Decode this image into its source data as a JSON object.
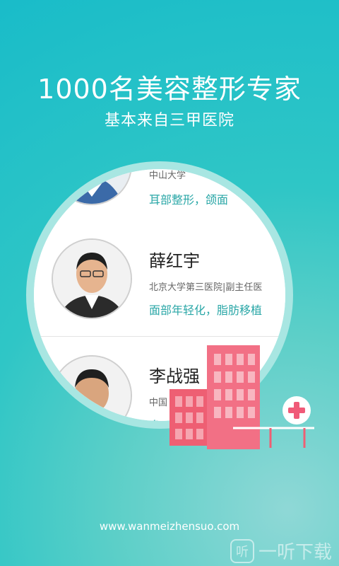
{
  "headline": "1000名美容整形专家",
  "subline": "基本来自三甲医院",
  "doctors": [
    {
      "name": "",
      "hospital": "中山大学",
      "specialty": "耳部整形，颌面"
    },
    {
      "name": "薛红宇",
      "hospital": "北京大学第三医院|副主任医",
      "specialty": "面部年轻化，脂肪移植"
    },
    {
      "name": "李战强",
      "hospital": "中国",
      "specialty": "鼻"
    }
  ],
  "website": "www.wanmeizhensuo.com",
  "watermark": {
    "icon_char": "听",
    "text": "一听下载"
  },
  "colors": {
    "teal_text": "#2aa7a7",
    "hospital_pink": "#f06a7a",
    "cross_red": "#f05a78"
  }
}
